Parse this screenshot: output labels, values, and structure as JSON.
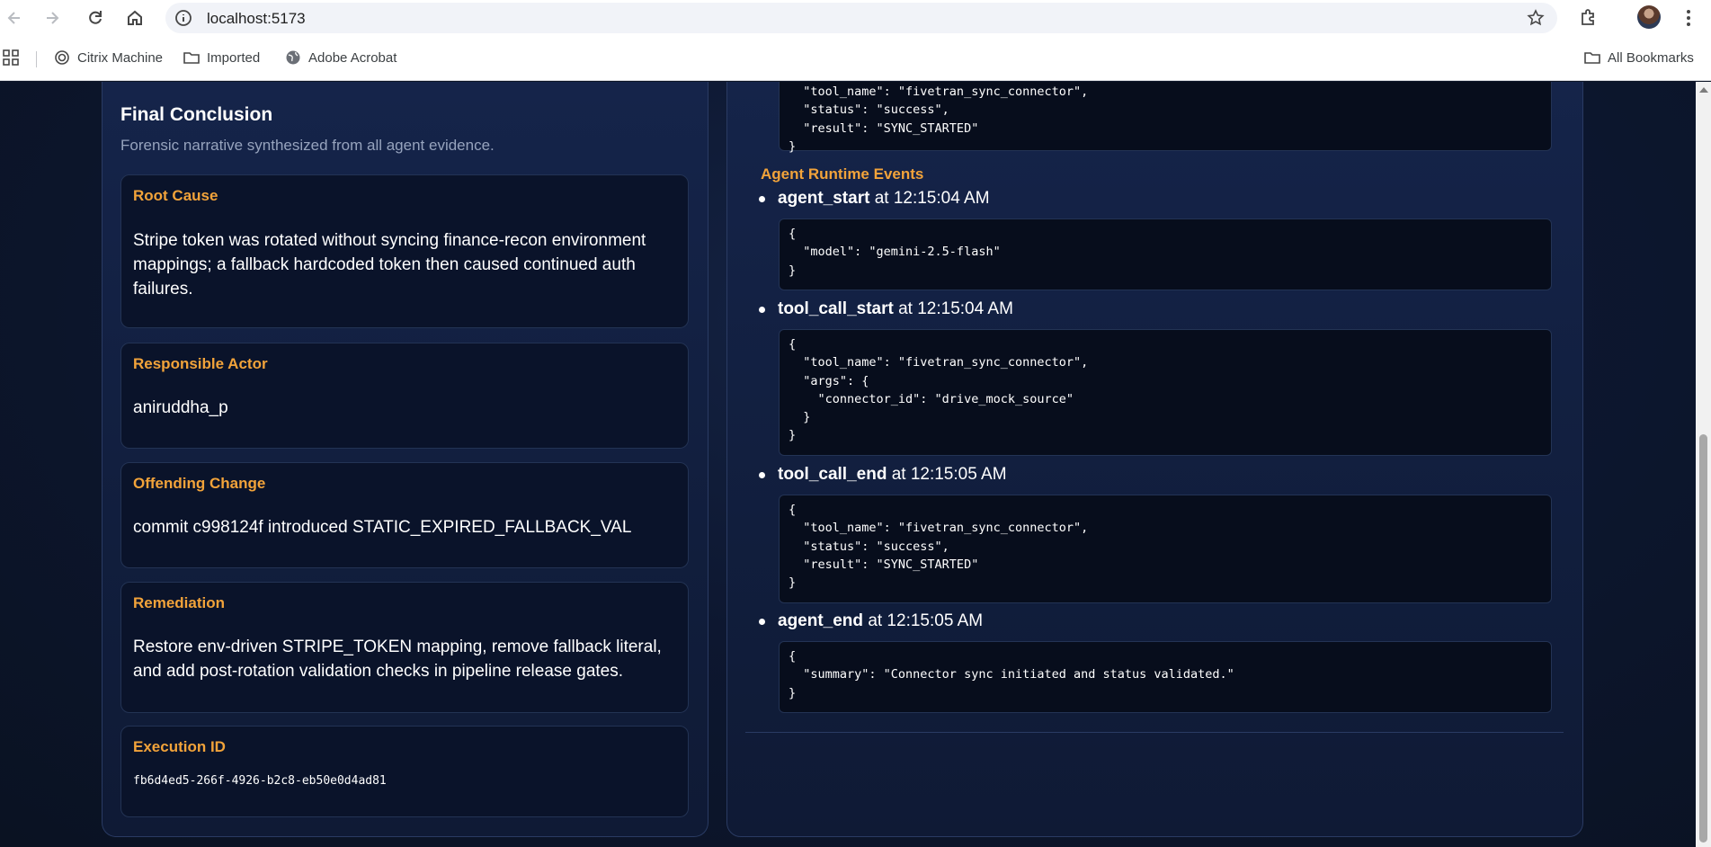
{
  "browser": {
    "url": "localhost:5173",
    "bookmarks": [
      "Citrix Machine",
      "Imported",
      "Adobe Acrobat"
    ],
    "all_bookmarks": "All Bookmarks"
  },
  "conclusion": {
    "title": "Final Conclusion",
    "subtitle": "Forensic narrative synthesized from all agent evidence.",
    "cards": [
      {
        "label": "Root Cause",
        "text": "Stripe token was rotated without syncing finance-recon environment mappings; a fallback hardcoded token then caused continued auth failures."
      },
      {
        "label": "Responsible Actor",
        "text": "aniruddha_p"
      },
      {
        "label": "Offending Change",
        "text": "commit c998124f introduced STATIC_EXPIRED_FALLBACK_VAL"
      },
      {
        "label": "Remediation",
        "text": "Restore env-driven STRIPE_TOKEN mapping, remove fallback literal, and add post-rotation validation checks in pipeline release gates."
      },
      {
        "label": "Execution ID",
        "text": "fb6d4ed5-266f-4926-b2c8-eb50e0d4ad81"
      }
    ]
  },
  "runtime": {
    "top_code": "  \"tool_name\": \"fivetran_sync_connector\",\n  \"status\": \"success\",\n  \"result\": \"SYNC_STARTED\"\n}",
    "heading": "Agent Runtime Events",
    "events": [
      {
        "name": "agent_start",
        "time": "at 12:15:04 AM",
        "code": "{\n  \"model\": \"gemini-2.5-flash\"\n}"
      },
      {
        "name": "tool_call_start",
        "time": "at 12:15:04 AM",
        "code": "{\n  \"tool_name\": \"fivetran_sync_connector\",\n  \"args\": {\n    \"connector_id\": \"drive_mock_source\"\n  }\n}"
      },
      {
        "name": "tool_call_end",
        "time": "at 12:15:05 AM",
        "code": "{\n  \"tool_name\": \"fivetran_sync_connector\",\n  \"status\": \"success\",\n  \"result\": \"SYNC_STARTED\"\n}"
      },
      {
        "name": "agent_end",
        "time": "at 12:15:05 AM",
        "code": "{\n  \"summary\": \"Connector sync initiated and status validated.\"\n}"
      }
    ]
  }
}
